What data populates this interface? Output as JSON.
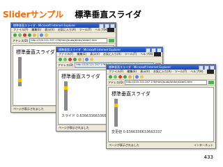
{
  "slide": {
    "title_accent": "Sliderサンプル",
    "title_main": "標準垂直スライダ",
    "page_number": "433"
  },
  "colors": {
    "accent": "#ff6600",
    "titlebar": "#1a46b8",
    "slider_thumb": "#f5c400",
    "slider_track": "#8a8a8a"
  },
  "window_common": {
    "menu_items": [
      "ファイル(F)",
      "編集(E)",
      "表示(V)",
      "お気に入り(A)",
      "ツール(T)",
      "ヘルプ(H)"
    ],
    "address_label": "アドレス(D)",
    "address_url": "http://220.221.247.176/html/jsudo/slider/slider2.htm",
    "go_label": "移動",
    "status_text": "ページが表示されました",
    "zone_text": "インターネット",
    "page_heading": "標準垂直スライダ"
  },
  "windows": [
    {
      "title": "標準垂直スライダ - Microsoft Internet Explorer",
      "readout": "",
      "slider_value_fraction": 0.85
    },
    {
      "title": "標準垂直スライダ - Microsoft Internet Explorer",
      "readout": "スライド 0.6366336633663337",
      "slider_value_fraction": 0.2
    },
    {
      "title": "標準垂直スライダ - Microsoft Internet Explorer",
      "readout": "変更値 0.6366336633663337",
      "slider_value_fraction": 0.2
    }
  ]
}
